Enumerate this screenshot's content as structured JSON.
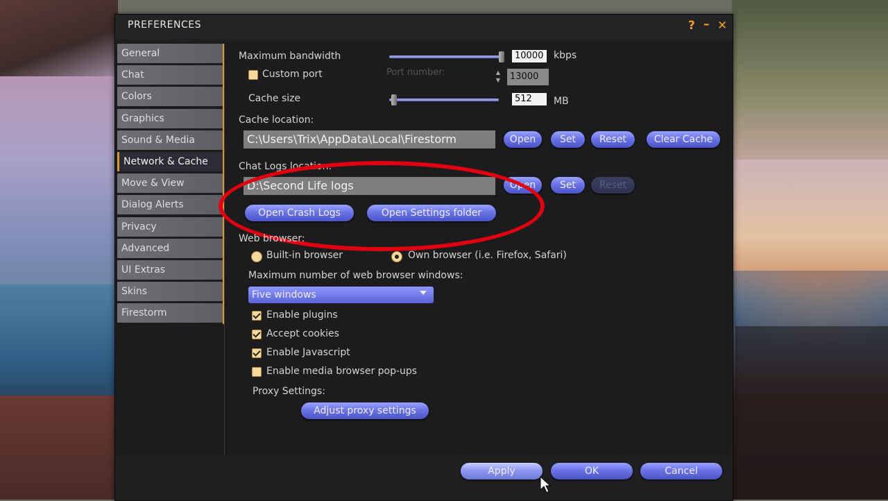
{
  "window": {
    "title": "PREFERENCES",
    "help": "?",
    "minimize": "–",
    "close": "✕"
  },
  "sidebar": [
    {
      "label": "General"
    },
    {
      "label": "Chat"
    },
    {
      "label": "Colors"
    },
    {
      "label": "Graphics"
    },
    {
      "label": "Sound & Media"
    },
    {
      "label": "Network & Cache",
      "active": true
    },
    {
      "label": "Move & View"
    },
    {
      "label": "Dialog Alerts"
    },
    {
      "label": "Privacy"
    },
    {
      "label": "Advanced"
    },
    {
      "label": "UI Extras"
    },
    {
      "label": "Skins"
    },
    {
      "label": "Firestorm"
    }
  ],
  "network": {
    "bandwidth_label": "Maximum bandwidth",
    "bandwidth_value": "10000",
    "bandwidth_unit": "kbps",
    "bandwidth_level": 1.0,
    "custom_port_label": "Custom port",
    "custom_port_checked": false,
    "port_number_label": "Port number:",
    "port_value": "13000",
    "cache_size_label": "Cache size",
    "cache_size_value": "512",
    "cache_size_unit": "MB",
    "cache_size_level": 0.02
  },
  "cache": {
    "location_label": "Cache location:",
    "path": "C:\\Users\\Trix\\AppData\\Local\\Firestorm",
    "open": "Open",
    "set": "Set",
    "reset": "Reset",
    "clear": "Clear Cache"
  },
  "chat_logs": {
    "location_label": "Chat Logs location:",
    "path": "D:\\Second Life logs",
    "open": "Open",
    "set": "Set",
    "reset": "Reset",
    "open_crash_logs": "Open Crash Logs",
    "open_settings_folder": "Open Settings folder"
  },
  "web": {
    "browser_label": "Web browser:",
    "builtin": "Built-in browser",
    "own": "Own browser (i.e. Firefox, Safari)",
    "selected": "own",
    "max_windows_label": "Maximum number of web browser windows:",
    "max_windows_value": "Five windows",
    "enable_plugins": "Enable plugins",
    "accept_cookies": "Accept cookies",
    "enable_javascript": "Enable Javascript",
    "enable_popups": "Enable media browser pop-ups",
    "proxy_label": "Proxy Settings:",
    "adjust_proxy": "Adjust proxy settings"
  },
  "footer": {
    "apply": "Apply",
    "ok": "OK",
    "cancel": "Cancel"
  },
  "colors": {
    "accent": "#d49a2c",
    "button": "#6b74e6",
    "annotation": "#e00010"
  }
}
